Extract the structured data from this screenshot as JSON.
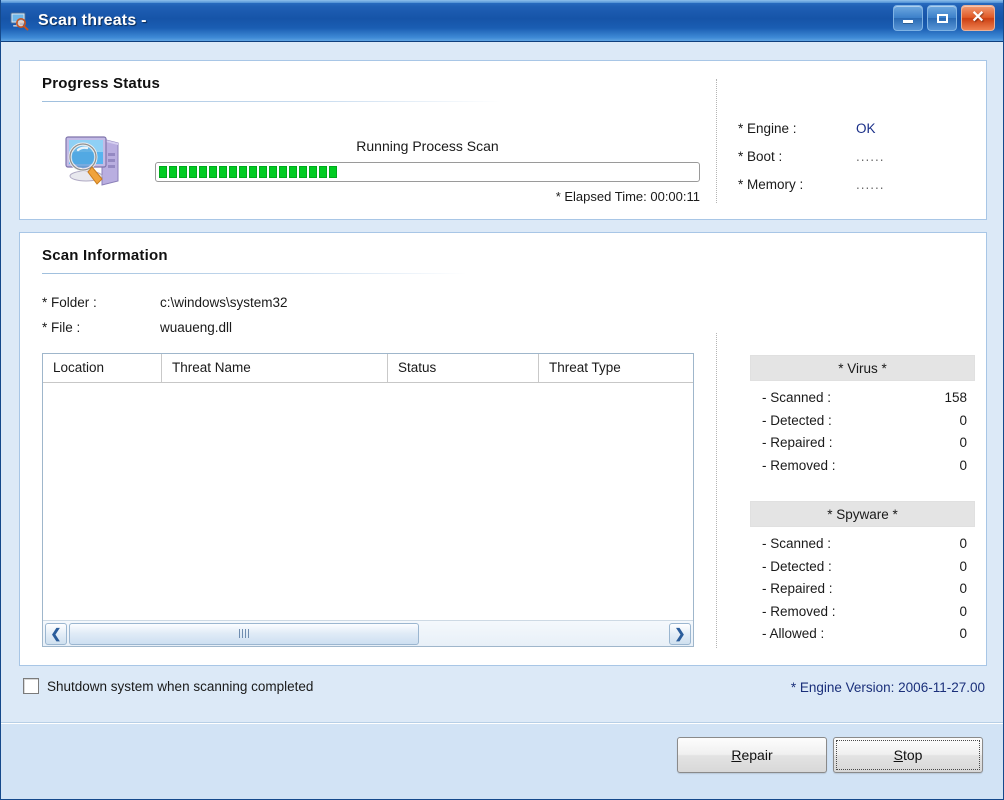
{
  "window": {
    "title": "Scan threats -",
    "icon": "scan-threats-icon",
    "controls": {
      "minimize": "minimize-icon",
      "maximize": "maximize-icon",
      "close": "close-icon"
    }
  },
  "progress_panel": {
    "title": "Progress Status",
    "icon": "computer-magnifier-icon",
    "current_task": "Running Process Scan",
    "progress_segments_filled": 18,
    "elapsed_time": "* Elapsed Time: 00:00:11",
    "status": [
      {
        "label": "* Engine :",
        "value": "OK",
        "is_dots": false
      },
      {
        "label": "* Boot :",
        "value": "......",
        "is_dots": true
      },
      {
        "label": "* Memory :",
        "value": "......",
        "is_dots": true
      }
    ]
  },
  "scan_info_panel": {
    "title": "Scan Information",
    "folder_label": "* Folder :",
    "folder_value": "c:\\windows\\system32",
    "file_label": "* File :",
    "file_value": "wuaueng.dll",
    "table": {
      "columns": [
        "Location",
        "Threat Name",
        "Status",
        "Threat Type"
      ],
      "rows": []
    },
    "scrollbar": {
      "left_arrow": "chevron-left-icon",
      "right_arrow": "chevron-right-icon",
      "grip": "grip-icon"
    },
    "virus": {
      "heading": "* Virus *",
      "rows": [
        {
          "label": "- Scanned :",
          "value": "158"
        },
        {
          "label": "- Detected :",
          "value": "0"
        },
        {
          "label": "- Repaired :",
          "value": "0"
        },
        {
          "label": "- Removed :",
          "value": "0"
        }
      ]
    },
    "spyware": {
      "heading": "* Spyware *",
      "rows": [
        {
          "label": "- Scanned :",
          "value": "0"
        },
        {
          "label": "- Detected :",
          "value": "0"
        },
        {
          "label": "- Repaired :",
          "value": "0"
        },
        {
          "label": "- Removed :",
          "value": "0"
        },
        {
          "label": "- Allowed :",
          "value": "0"
        }
      ]
    }
  },
  "bottom": {
    "shutdown_checkbox_label": "Shutdown system when scanning completed",
    "shutdown_checked": false,
    "engine_version": "* Engine Version: 2006-11-27.00"
  },
  "footer": {
    "repair_button": {
      "prefix": "",
      "accel": "R",
      "suffix": "epair"
    },
    "stop_button": {
      "prefix": "",
      "accel": "S",
      "suffix": "top"
    }
  },
  "colors": {
    "titlebar_blue": "#1f5fb4",
    "window_bg": "#dce9f7",
    "progress_green": "#00cc22",
    "accent_text_blue": "#1a2f88",
    "close_red": "#e05a27"
  }
}
